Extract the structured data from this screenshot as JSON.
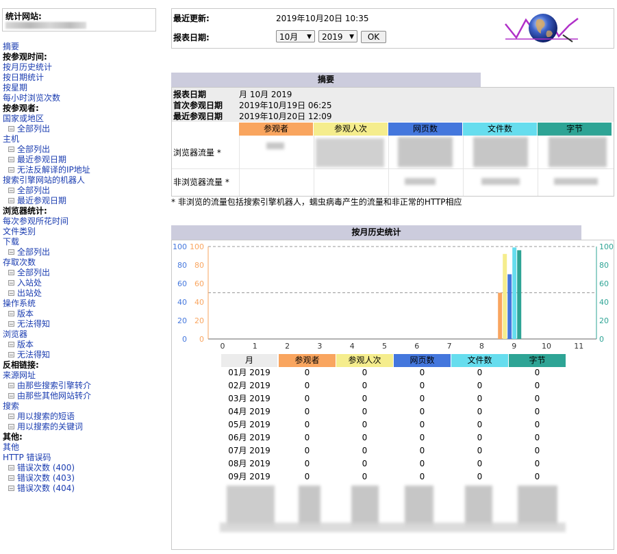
{
  "site": {
    "label": "统计网站:"
  },
  "menu": [
    {
      "label": "摘要",
      "kind": "link"
    },
    {
      "label": "按参观时间:",
      "kind": "sec"
    },
    {
      "label": "按月历史统计",
      "kind": "link"
    },
    {
      "label": "按日期统计",
      "kind": "link"
    },
    {
      "label": "按星期",
      "kind": "link"
    },
    {
      "label": "每小时浏览次数",
      "kind": "link"
    },
    {
      "label": "按参观者:",
      "kind": "sec"
    },
    {
      "label": "国家或地区",
      "kind": "link"
    },
    {
      "label": "全部列出",
      "kind": "sub"
    },
    {
      "label": "主机",
      "kind": "link"
    },
    {
      "label": "全部列出",
      "kind": "sub"
    },
    {
      "label": "最近参观日期",
      "kind": "sub"
    },
    {
      "label": "无法反解译的IP地址",
      "kind": "sub"
    },
    {
      "label": "搜索引擎网站的机器人",
      "kind": "link"
    },
    {
      "label": "全部列出",
      "kind": "sub"
    },
    {
      "label": "最近参观日期",
      "kind": "sub"
    },
    {
      "label": "浏览器统计:",
      "kind": "sec"
    },
    {
      "label": "每次参观所花时间",
      "kind": "link"
    },
    {
      "label": "文件类别",
      "kind": "link"
    },
    {
      "label": "下载",
      "kind": "link"
    },
    {
      "label": "全部列出",
      "kind": "sub"
    },
    {
      "label": "存取次数",
      "kind": "link"
    },
    {
      "label": "全部列出",
      "kind": "sub"
    },
    {
      "label": "入站处",
      "kind": "sub"
    },
    {
      "label": "出站处",
      "kind": "sub"
    },
    {
      "label": "操作系统",
      "kind": "link"
    },
    {
      "label": "版本",
      "kind": "sub"
    },
    {
      "label": "无法得知",
      "kind": "sub"
    },
    {
      "label": "浏览器",
      "kind": "link"
    },
    {
      "label": "版本",
      "kind": "sub"
    },
    {
      "label": "无法得知",
      "kind": "sub"
    },
    {
      "label": "反相链接:",
      "kind": "sec"
    },
    {
      "label": "来源网址",
      "kind": "link"
    },
    {
      "label": "由那些搜索引擎转介",
      "kind": "sub"
    },
    {
      "label": "由那些其他网站转介",
      "kind": "sub"
    },
    {
      "label": "搜索",
      "kind": "link"
    },
    {
      "label": "用以搜索的短语",
      "kind": "sub"
    },
    {
      "label": "用以搜索的关键词",
      "kind": "sub"
    },
    {
      "label": "其他:",
      "kind": "sec"
    },
    {
      "label": "其他",
      "kind": "link"
    },
    {
      "label": "HTTP 错误码",
      "kind": "link"
    },
    {
      "label": "错误次数 (400)",
      "kind": "sub"
    },
    {
      "label": "错误次数 (403)",
      "kind": "sub"
    },
    {
      "label": "错误次数 (404)",
      "kind": "sub"
    }
  ],
  "top": {
    "updated_label": "最近更新:",
    "updated_value": "2019年10月20日 10:35",
    "report_label": "报表日期:",
    "month_value": "10月",
    "year_value": "2019",
    "ok_label": "OK"
  },
  "summary": {
    "title": "摘要",
    "rows": [
      {
        "label": "报表日期",
        "value": "月 10月 2019"
      },
      {
        "label": "首次参观日期",
        "value": "2019年10月19日 06:25"
      },
      {
        "label": "最近参观日期",
        "value": "2019年10月20日 12:09"
      }
    ],
    "headers": [
      "参观者",
      "参观人次",
      "网页数",
      "文件数",
      "字节"
    ],
    "viewed_label": "浏览器流量 *",
    "notviewed_label": "非浏览器流量 *",
    "note": "* 非浏览的流量包括搜索引擎机器人，蠕虫病毒产生的流量和非正常的HTTP相应"
  },
  "colors": {
    "visitors": "#f9a55f",
    "visits": "#f5ed8d",
    "pages": "#4477dd",
    "hits": "#66ddee",
    "bytes": "#2ea495"
  },
  "history": {
    "title": "按月历史统计",
    "col_month": "月",
    "headers": [
      "参观者",
      "参观人次",
      "网页数",
      "文件数",
      "字节"
    ],
    "rows": [
      {
        "month": "01月 2019",
        "v": [
          "0",
          "0",
          "0",
          "0",
          "0"
        ]
      },
      {
        "month": "02月 2019",
        "v": [
          "0",
          "0",
          "0",
          "0",
          "0"
        ]
      },
      {
        "month": "03月 2019",
        "v": [
          "0",
          "0",
          "0",
          "0",
          "0"
        ]
      },
      {
        "month": "04月 2019",
        "v": [
          "0",
          "0",
          "0",
          "0",
          "0"
        ]
      },
      {
        "month": "05月 2019",
        "v": [
          "0",
          "0",
          "0",
          "0",
          "0"
        ]
      },
      {
        "month": "06月 2019",
        "v": [
          "0",
          "0",
          "0",
          "0",
          "0"
        ]
      },
      {
        "month": "07月 2019",
        "v": [
          "0",
          "0",
          "0",
          "0",
          "0"
        ]
      },
      {
        "month": "08月 2019",
        "v": [
          "0",
          "0",
          "0",
          "0",
          "0"
        ]
      },
      {
        "month": "09月 2019",
        "v": [
          "0",
          "0",
          "0",
          "0",
          "0"
        ]
      }
    ]
  },
  "chart_data": {
    "type": "bar",
    "x_ticks": [
      "0",
      "1",
      "2",
      "3",
      "4",
      "5",
      "6",
      "7",
      "8",
      "9",
      "10",
      "11"
    ],
    "y_left_ticks": [
      "0",
      "20",
      "40",
      "60",
      "80",
      "100"
    ],
    "y_left_blue_ticks": [
      "0",
      "20",
      "40",
      "60",
      "80",
      "100"
    ],
    "y_right_ticks": [
      "0",
      "20",
      "40",
      "60",
      "80",
      "100"
    ],
    "ylim": [
      0,
      100
    ],
    "grid": "dashed lines at 50 and 100",
    "series": [
      {
        "name": "参观者",
        "color": "#f9a55f",
        "category": 9,
        "value": 50
      },
      {
        "name": "参观人次",
        "color": "#f5ed8d",
        "category": 9,
        "value": 92
      },
      {
        "name": "网页数",
        "color": "#4477dd",
        "category": 9,
        "value": 70
      },
      {
        "name": "文件数",
        "color": "#66ddee",
        "category": 9,
        "value": 99
      },
      {
        "name": "字节",
        "color": "#2ea495",
        "category": 9,
        "value": 96
      }
    ]
  }
}
